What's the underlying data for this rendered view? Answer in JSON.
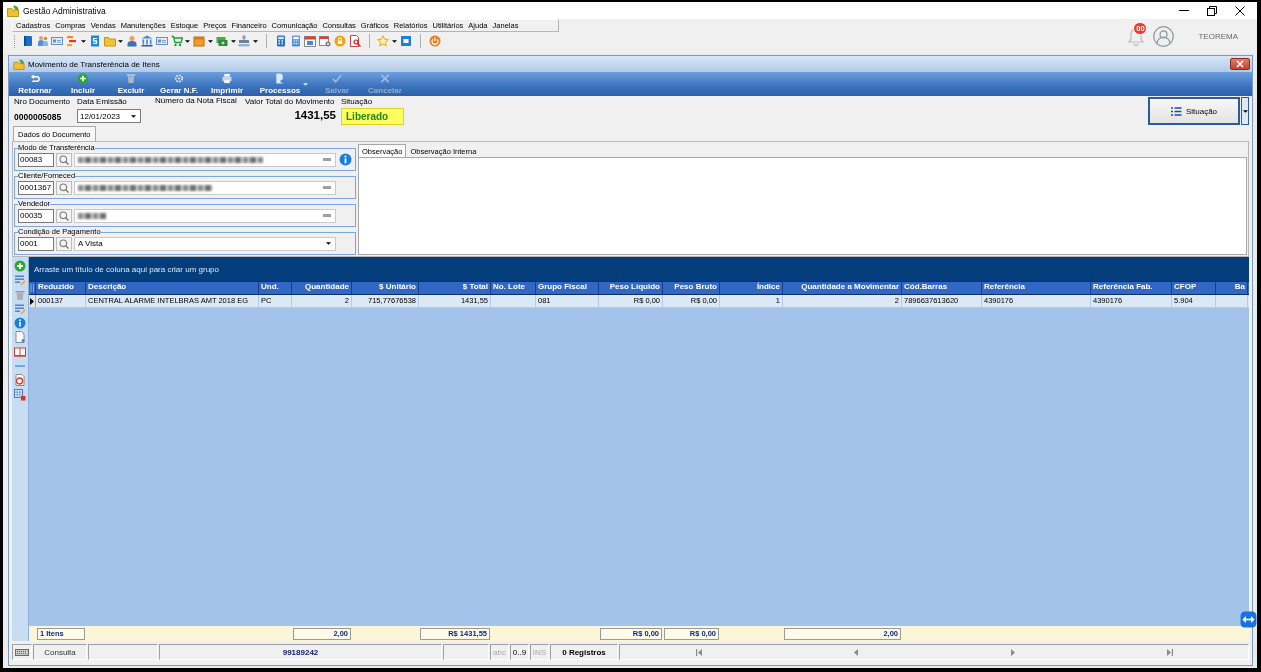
{
  "window": {
    "title": "Gestão Administrativa"
  },
  "menu": [
    "Cadastros",
    "Compras",
    "Vendas",
    "Manutenções",
    "Estoque",
    "Preços",
    "Financeiro",
    "Comunicação",
    "Consultas",
    "Gráficos",
    "Relatórios",
    "Utilitários",
    "Ajuda",
    "Janelas"
  ],
  "notifications": {
    "badge": "00"
  },
  "user": {
    "name": "TEOREMA"
  },
  "child_window": {
    "title": "Movimento de Transferência de Itens",
    "toolbar": [
      {
        "label": "Retornar",
        "disabled": false,
        "has_menu": false
      },
      {
        "label": "Incluir",
        "disabled": false,
        "has_menu": false
      },
      {
        "label": "Excluir",
        "disabled": false,
        "has_menu": false
      },
      {
        "label": "Gerar N.F.",
        "disabled": false,
        "has_menu": false
      },
      {
        "label": "Imprimir",
        "disabled": false,
        "has_menu": false
      },
      {
        "label": "Processos",
        "disabled": false,
        "has_menu": true
      },
      {
        "label": "Salvar",
        "disabled": true,
        "has_menu": false
      },
      {
        "label": "Cancelar",
        "disabled": true,
        "has_menu": false
      }
    ],
    "document": {
      "number_label": "Nro Documento",
      "number": "0000005085",
      "date_label": "Data Emissão",
      "date": "12/01/2023",
      "invoice_label": "Número da Nota Fiscal",
      "total_label": "Valor Total do Movimento",
      "total": "1431,55",
      "status_label": "Situação",
      "status": "Liberado",
      "status_button": "Situação"
    },
    "tabs": [
      {
        "label": "Dados do Documento",
        "selected": true
      }
    ],
    "groups": [
      {
        "legend": "Modo de Transferência",
        "code": "00083",
        "kind": "redacted",
        "info_button": true
      },
      {
        "legend": "Cliente/Forneced",
        "code": "0001367",
        "kind": "redacted",
        "info_button": false
      },
      {
        "legend": "Vendedor",
        "code": "00035",
        "kind": "redacted",
        "info_button": false
      },
      {
        "legend": "Condição de Pagamento",
        "code": "0001",
        "kind": "dropdown",
        "value": "A Vista",
        "info_button": false
      }
    ],
    "notes_tabs": [
      {
        "label": "Observação",
        "selected": true
      },
      {
        "label": "Observação Interna",
        "selected": false
      }
    ],
    "grid": {
      "group_hint": "Arraste um título de coluna aqui para criar um grupo",
      "columns": [
        {
          "label": "Reduzido",
          "summary": "1 Itens"
        },
        {
          "label": "Descrição"
        },
        {
          "label": "Und."
        },
        {
          "label": "Quantidade",
          "summary": "2,00"
        },
        {
          "label": "$ Unitário"
        },
        {
          "label": "$ Total",
          "summary": "R$ 1431,55"
        },
        {
          "label": "No. Lote"
        },
        {
          "label": "Grupo Fiscal"
        },
        {
          "label": "Peso Líquido",
          "summary": "R$ 0,00"
        },
        {
          "label": "Peso Bruto",
          "summary": "R$ 0,00"
        },
        {
          "label": "Índice"
        },
        {
          "label": "Quantidade a Movimentar",
          "summary": "2,00"
        },
        {
          "label": "Cód.Barras"
        },
        {
          "label": "Referência"
        },
        {
          "label": "Referência Fab."
        },
        {
          "label": "CFOP"
        },
        {
          "label": "Ba"
        }
      ],
      "rows": [
        {
          "selected": true,
          "cells": [
            "000137",
            "CENTRAL ALARME INTELBRAS AMT 2018 EG",
            "PC",
            "2",
            "715,77676538",
            "1431,55",
            null,
            "081",
            "R$ 0,00",
            "R$ 0,00",
            "1",
            "2",
            "7896637613620",
            "4390176",
            "4390176",
            "5.904",
            null
          ]
        }
      ]
    }
  },
  "status_bar": {
    "mode": "Consulta",
    "code": "99189242",
    "indicators": [
      {
        "text": "abc",
        "active": false
      },
      {
        "text": "0..9",
        "active": true
      },
      {
        "text": "INS",
        "active": false
      }
    ],
    "records": "0 Registros"
  }
}
